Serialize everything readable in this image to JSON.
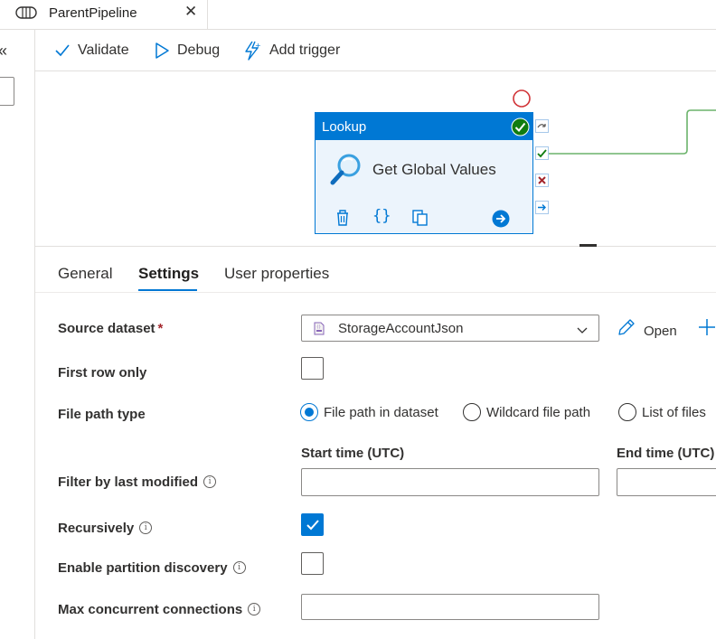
{
  "tab": {
    "title": "ParentPipeline",
    "close": "✕"
  },
  "leftrail": {
    "collapse": "«"
  },
  "toolbar": {
    "validate": "Validate",
    "debug": "Debug",
    "add_trigger": "Add trigger"
  },
  "activity": {
    "type": "Lookup",
    "name": "Get Global Values"
  },
  "props_tabs": [
    "General",
    "Settings",
    "User properties"
  ],
  "form": {
    "source_dataset_label": "Source dataset",
    "required_mark": "*",
    "source_dataset_value": "StorageAccountJson",
    "open_label": "Open",
    "first_row_only_label": "First row only",
    "file_path_type_label": "File path type",
    "file_path_options": [
      "File path in dataset",
      "Wildcard file path",
      "List of files"
    ],
    "start_time_label": "Start time (UTC)",
    "end_time_label": "End time (UTC)",
    "filter_label": "Filter by last modified",
    "recursively_label": "Recursively",
    "partition_label": "Enable partition discovery",
    "max_conn_label": "Max concurrent connections",
    "info_glyph": "i"
  },
  "colors": {
    "accent": "#0078d4",
    "success": "#107c10",
    "error": "#a4262c",
    "link_line": "#6bb36b",
    "breakpoint": "#d13438"
  }
}
